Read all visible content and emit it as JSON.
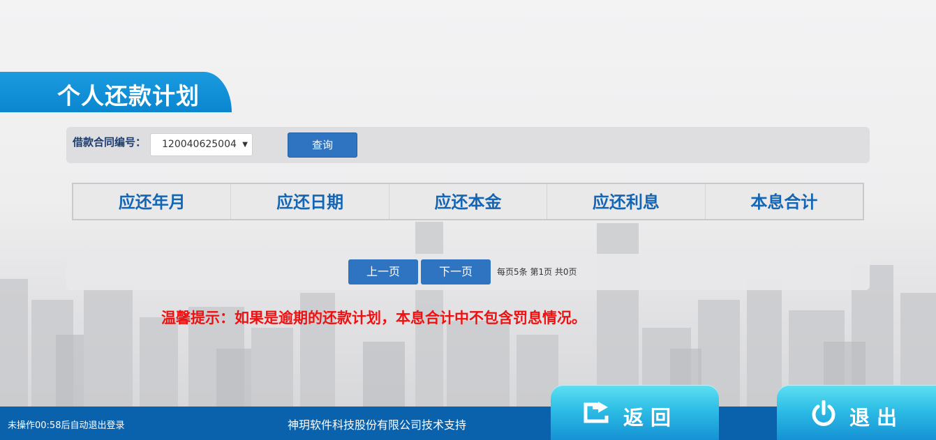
{
  "header": {
    "title": "个人还款计划"
  },
  "query": {
    "contract_label": "借款合同编号：",
    "contract_value": "120040625004",
    "query_label": "查询"
  },
  "table": {
    "columns": [
      "应还年月",
      "应还日期",
      "应还本金",
      "应还利息",
      "本息合计"
    ],
    "rows": []
  },
  "pager": {
    "prev_label": "上一页",
    "next_label": "下一页",
    "info": "每页5条 第1页 共0页"
  },
  "notice": "温馨提示：如果是逾期的还款计划，本息合计中不包含罚息情况。",
  "footer": {
    "idle_text": "未操作00:58后自动退出登录",
    "support_text": "神玥软件科技股份有限公司技术支持",
    "back_label": "返回",
    "exit_label": "退出"
  },
  "colors": {
    "accent_blue": "#1b9be0",
    "button_blue": "#2f74c0",
    "header_text": "#1465b3",
    "notice_red": "#ee1111",
    "footer_blue": "#0a62ad"
  },
  "icons": {
    "select": "chevron-down-icon",
    "back": "return-arrow-icon",
    "exit": "power-icon"
  }
}
